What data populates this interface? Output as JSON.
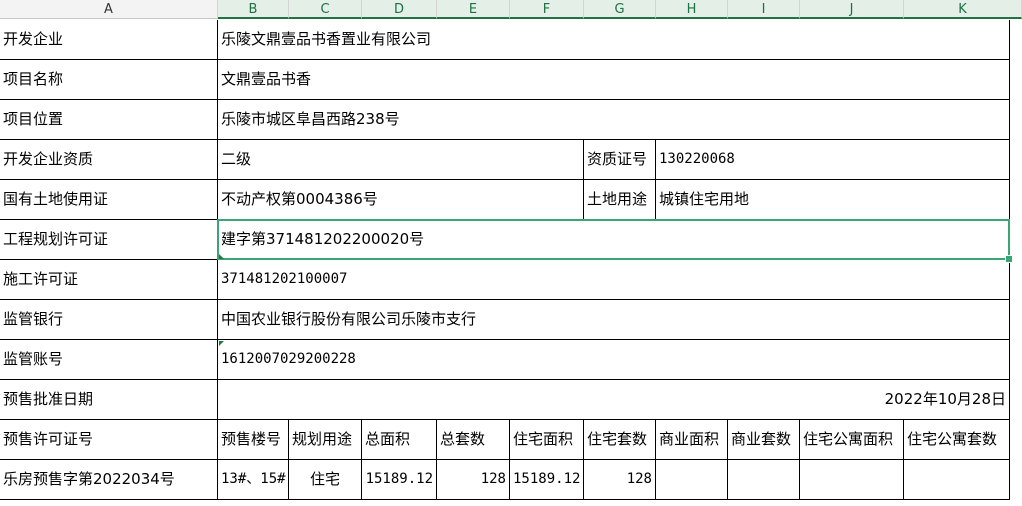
{
  "columns": [
    "A",
    "B",
    "C",
    "D",
    "E",
    "F",
    "G",
    "H",
    "I",
    "J",
    "K"
  ],
  "rows": {
    "r1": {
      "label": "开发企业",
      "value": "乐陵文鼎壹品书香置业有限公司"
    },
    "r2": {
      "label": "项目名称",
      "value": "文鼎壹品书香"
    },
    "r3": {
      "label": "项目位置",
      "value": "乐陵市城区阜昌西路238号"
    },
    "r4": {
      "label": "开发企业资质",
      "value": "二级",
      "sub_label": "资质证号",
      "sub_value": "130220068"
    },
    "r5": {
      "label": "国有土地使用证",
      "value": "不动产权第0004386号",
      "sub_label": "土地用途",
      "sub_value": "城镇住宅用地"
    },
    "r6": {
      "label": "工程规划许可证",
      "value": "建字第371481202200020号"
    },
    "r7": {
      "label": "施工许可证",
      "value": "371481202100007"
    },
    "r8": {
      "label": "监管银行",
      "value": "中国农业银行股份有限公司乐陵市支行"
    },
    "r9": {
      "label": "监管账号",
      "value": "1612007029200228"
    },
    "r10": {
      "label": "预售批准日期",
      "value": "2022年10月28日"
    }
  },
  "permit_table": {
    "header_label": "预售许可证号",
    "headers": [
      "预售楼号",
      "规划用途",
      "总面积",
      "总套数",
      "住宅面积",
      "住宅套数",
      "商业面积",
      "商业套数",
      "住宅公寓面积",
      "住宅公寓套数"
    ],
    "row": {
      "permit_no": "乐房预售字第2022034号",
      "values": [
        "13#、15#",
        "住宅",
        "15189.12",
        "128",
        "15189.12",
        "128",
        "",
        "",
        "",
        ""
      ]
    }
  }
}
